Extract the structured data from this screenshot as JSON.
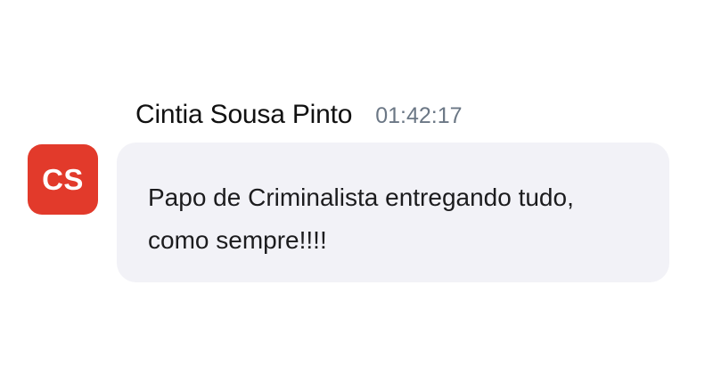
{
  "message": {
    "avatar_initials": "CS",
    "avatar_color": "#e23a2b",
    "sender_name": "Cintia Sousa Pinto",
    "timestamp": "01:42:17",
    "text": "Papo de Criminalista entregando tudo, como sempre!!!!"
  }
}
